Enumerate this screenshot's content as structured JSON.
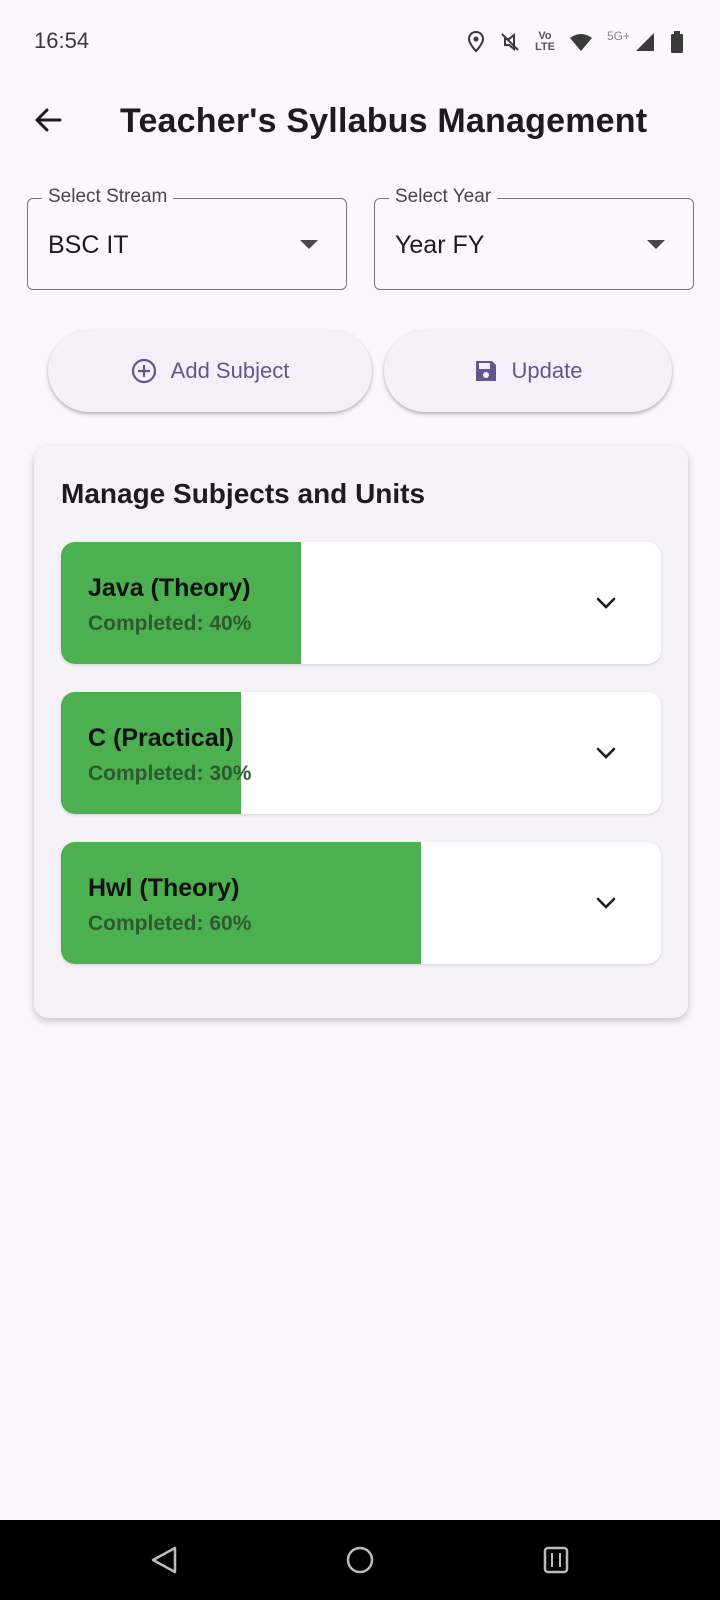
{
  "status_bar": {
    "time": "16:54",
    "network_label_top": "Vo",
    "network_label_bottom": "LTE",
    "network_gen": "5G+",
    "icons": [
      "location-icon",
      "mute-icon",
      "volte-icon",
      "wifi-icon",
      "signal-icon",
      "battery-icon"
    ]
  },
  "app_bar": {
    "title": "Teacher's Syllabus Management",
    "back_icon": "arrow-left-icon"
  },
  "filters": {
    "stream": {
      "label": "Select Stream",
      "value": "BSC IT"
    },
    "year": {
      "label": "Select Year",
      "value": "Year FY"
    }
  },
  "actions": {
    "add_label": "Add Subject",
    "add_icon": "plus-circle-icon",
    "update_label": "Update",
    "update_icon": "save-icon"
  },
  "card": {
    "title": "Manage Subjects and Units",
    "subjects": [
      {
        "name": "Java (Theory)",
        "progress_text": "Completed: 40%",
        "progress": 0.4
      },
      {
        "name": "C (Practical)",
        "progress_text": "Completed: 30%",
        "progress": 0.3
      },
      {
        "name": "Hwl (Theory)",
        "progress_text": "Completed: 60%",
        "progress": 0.6
      }
    ]
  },
  "colors": {
    "background": "#fcf6fd",
    "accent": "#65558f",
    "progress_fill": "#4caf50",
    "card_bg": "#f5f2f7"
  },
  "nav_bar": {
    "icons": [
      "nav-back-icon",
      "nav-home-icon",
      "nav-recents-icon"
    ]
  }
}
